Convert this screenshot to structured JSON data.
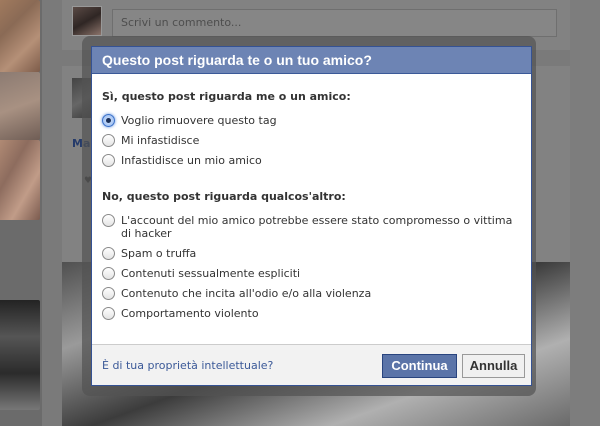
{
  "background": {
    "comment_placeholder": "Scrivi un commento...",
    "post_author_partial": "Ma"
  },
  "dialog": {
    "title": "Questo post riguarda te o un tuo amico?",
    "section_me": {
      "heading": "Sì, questo post riguarda me o un amico:",
      "options": [
        {
          "label": "Voglio rimuovere questo tag",
          "checked": true
        },
        {
          "label": "Mi infastidisce",
          "checked": false
        },
        {
          "label": "Infastidisce un mio amico",
          "checked": false
        }
      ]
    },
    "section_other": {
      "heading": "No, questo post riguarda qualcos'altro:",
      "options": [
        {
          "label": "L'account del mio amico potrebbe essere stato compromesso o vittima di hacker",
          "checked": false
        },
        {
          "label": "Spam o truffa",
          "checked": false
        },
        {
          "label": "Contenuti sessualmente espliciti",
          "checked": false
        },
        {
          "label": "Contenuto che incita all'odio e/o alla violenza",
          "checked": false
        },
        {
          "label": "Comportamento violento",
          "checked": false
        }
      ]
    },
    "footer": {
      "ip_link": "È di tua proprietà intellettuale?",
      "continue_label": "Continua",
      "cancel_label": "Annulla"
    }
  },
  "colors": {
    "header_bg": "#6d84b4",
    "primary_button": "#5b74a8",
    "link": "#3b5998"
  }
}
